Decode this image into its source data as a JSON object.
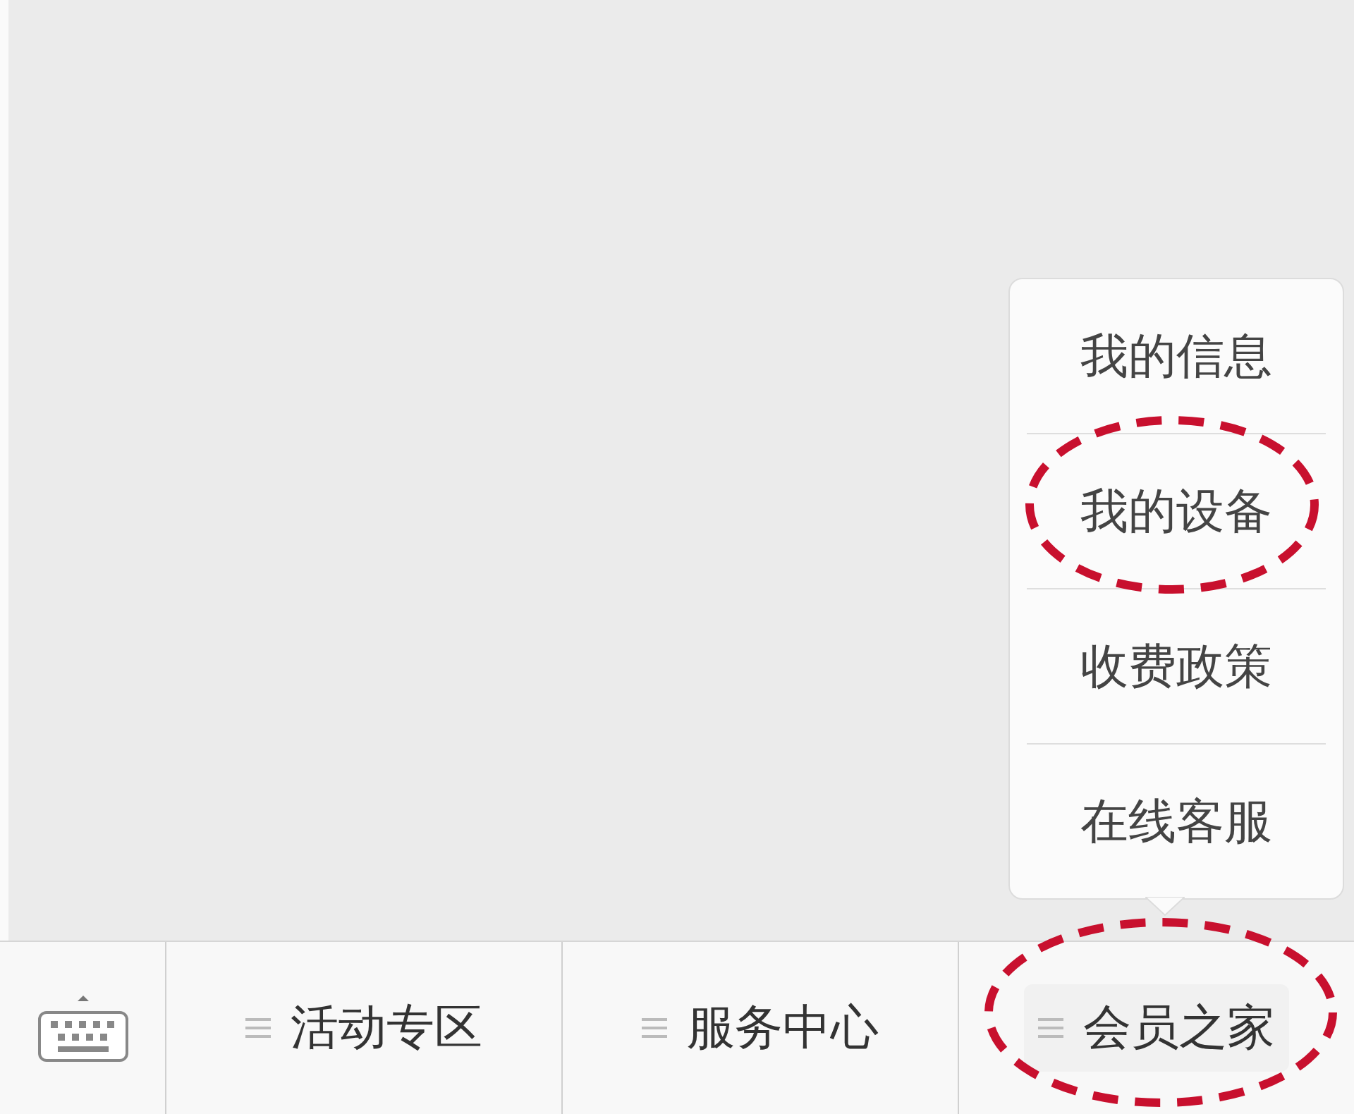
{
  "menu_bar": {
    "items": [
      {
        "label": "活动专区",
        "expanded": false,
        "annotated": false
      },
      {
        "label": "服务中心",
        "expanded": false,
        "annotated": false
      },
      {
        "label": "会员之家",
        "expanded": true,
        "annotated": true,
        "children": [
          {
            "label": "我的信息",
            "annotated": false
          },
          {
            "label": "我的设备",
            "annotated": true
          },
          {
            "label": "收费政策",
            "annotated": false
          },
          {
            "label": "在线客服",
            "annotated": false
          }
        ]
      }
    ]
  }
}
